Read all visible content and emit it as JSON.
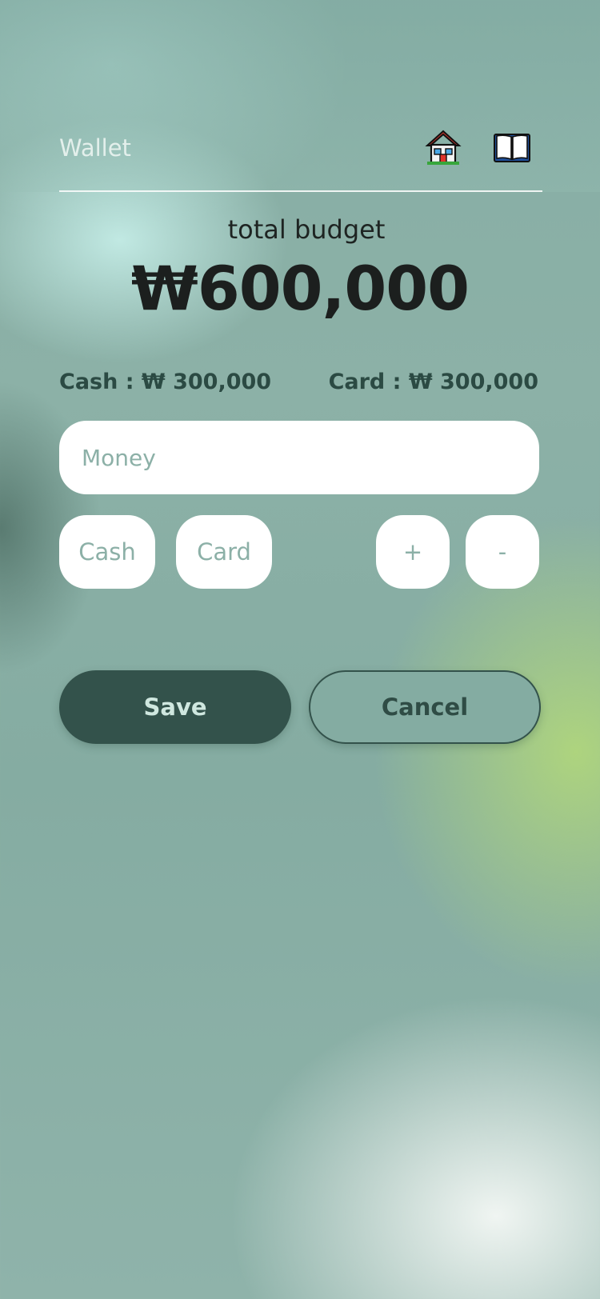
{
  "header": {
    "title": "Wallet",
    "home_icon": "home-icon",
    "book_icon": "book-icon"
  },
  "budget": {
    "label": "total budget",
    "amount": "₩600,000"
  },
  "split": {
    "cash": "Cash : ₩ 300,000",
    "card": "Card : ₩ 300,000"
  },
  "input": {
    "placeholder": "Money",
    "value": ""
  },
  "buttons": {
    "cash": "Cash",
    "card": "Card",
    "plus": "+",
    "minus": "-",
    "save": "Save",
    "cancel": "Cancel"
  },
  "colors": {
    "accent_dark": "#33524b",
    "button_text": "#8cb0a7",
    "background": "#86ada4"
  }
}
